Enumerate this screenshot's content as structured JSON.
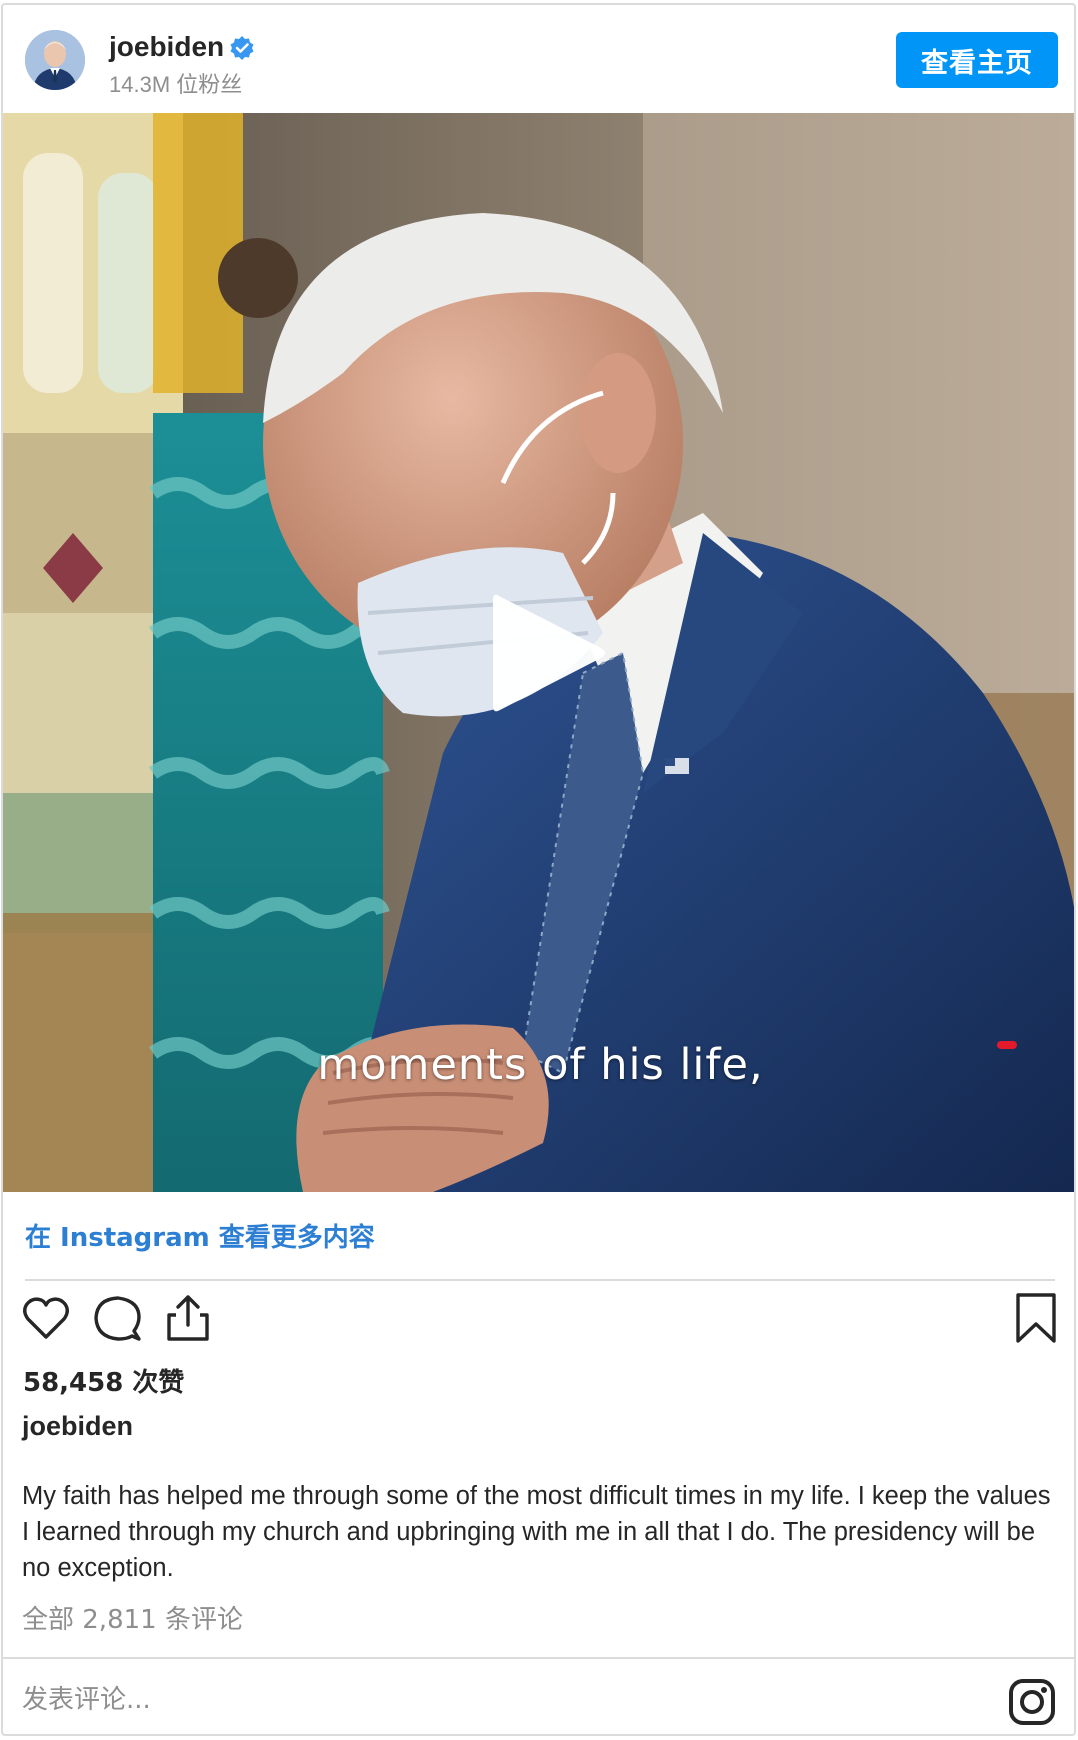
{
  "header": {
    "username": "joebiden",
    "followers": "14.3M 位粉丝",
    "view_profile_label": "查看主页",
    "verified_icon": "verified-badge-icon",
    "accent_color": "#0095f6"
  },
  "media": {
    "type": "video",
    "subtitle": "moments of his life,",
    "play_icon": "play-icon"
  },
  "more_link": "在 Instagram 查看更多内容",
  "actions": {
    "like_icon": "heart-icon",
    "comment_icon": "comment-icon",
    "share_icon": "share-icon",
    "save_icon": "bookmark-icon"
  },
  "likes": "58,458 次赞",
  "caption": {
    "username": "joebiden",
    "text": "My faith has helped me through some of the most difficult times in my life. I keep the values I learned through my church and upbringing with me in all that I do. The presidency will be no exception."
  },
  "view_comments": "全部 2,811 条评论",
  "comment_box": {
    "placeholder": "发表评论...",
    "instagram_icon": "instagram-logo-icon"
  }
}
